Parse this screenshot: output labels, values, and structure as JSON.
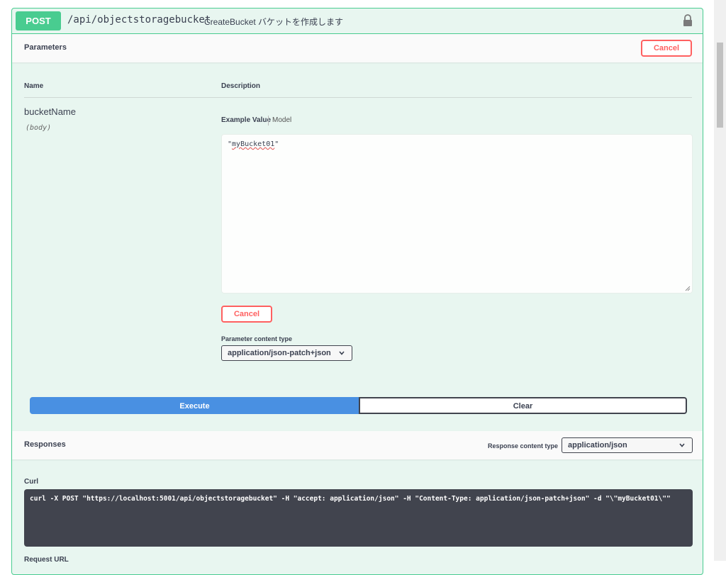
{
  "endpoint": {
    "method": "POST",
    "path": "/api/objectstoragebucket",
    "description": "CreateBucket バケットを作成します",
    "lock_icon": "lock-icon"
  },
  "parameters": {
    "title": "Parameters",
    "cancel_label": "Cancel",
    "col_name": "Name",
    "col_description": "Description",
    "param": {
      "name": "bucketName",
      "in": "(body)",
      "tab_example": "Example Value",
      "tab_model": "Model",
      "body_value": "\"myBucket01\"",
      "body_quote_open": "\"",
      "body_word": "myBucket01",
      "body_quote_close": "\"",
      "cancel_label": "Cancel",
      "content_type_label": "Parameter content type",
      "content_type_value": "application/json-patch+json"
    }
  },
  "actions": {
    "execute_label": "Execute",
    "clear_label": "Clear"
  },
  "responses": {
    "title": "Responses",
    "content_type_label": "Response content type",
    "content_type_value": "application/json",
    "curl_label": "Curl",
    "curl_command": "curl -X POST \"https://localhost:5001/api/objectstoragebucket\" -H \"accept: application/json\" -H \"Content-Type: application/json-patch+json\" -d \"\\\"myBucket01\\\"\"",
    "request_url_label": "Request URL"
  },
  "colors": {
    "post_green": "#49cc90",
    "execute_blue": "#4990e2",
    "cancel_red": "#ff6060",
    "curl_bg": "#41444e"
  }
}
